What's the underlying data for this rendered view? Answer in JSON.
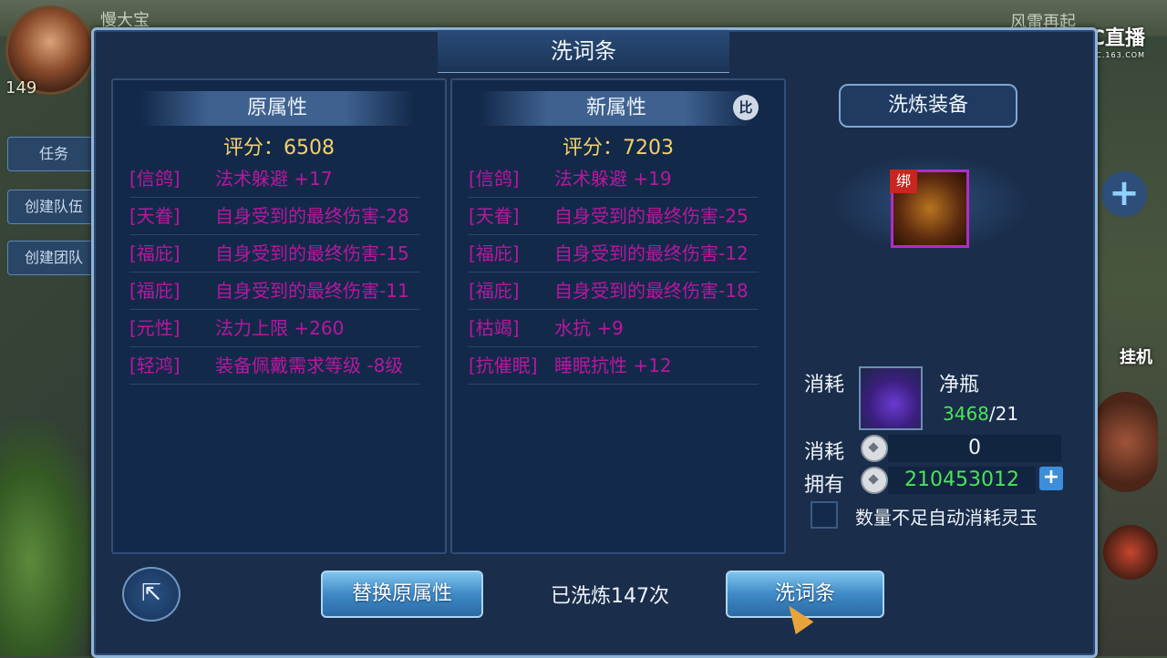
{
  "background": {
    "player_name": "慢大宝",
    "level": "149",
    "side_buttons": [
      "任务",
      "创建队伍",
      "创建团队"
    ],
    "top_right_text": "风雷再起",
    "right_hang": "挂机",
    "stream_logo": "CC直播",
    "stream_logo_sub": "CC.163.COM"
  },
  "dialog": {
    "title": "洗词条"
  },
  "original": {
    "header": "原属性",
    "score": "评分：6508",
    "attributes": [
      {
        "tag": "[信鸽]",
        "text": "法术躲避 +17"
      },
      {
        "tag": "[天眷]",
        "text": "自身受到的最终伤害-28"
      },
      {
        "tag": "[福庇]",
        "text": "自身受到的最终伤害-15"
      },
      {
        "tag": "[福庇]",
        "text": "自身受到的最终伤害-11"
      },
      {
        "tag": "[元性]",
        "text": "法力上限 +260"
      },
      {
        "tag": "[轻鸿]",
        "text": "装备佩戴需求等级 -8级"
      }
    ]
  },
  "new": {
    "header": "新属性",
    "compare_badge": "比",
    "score": "评分：7203",
    "attributes": [
      {
        "tag": "[信鸽]",
        "text": "法术躲避 +19"
      },
      {
        "tag": "[天眷]",
        "text": "自身受到的最终伤害-25"
      },
      {
        "tag": "[福庇]",
        "text": "自身受到的最终伤害-12"
      },
      {
        "tag": "[福庇]",
        "text": "自身受到的最终伤害-18"
      },
      {
        "tag": "[枯竭]",
        "text": "水抗 +9"
      },
      {
        "tag": "[抗催眠]",
        "text": "睡眠抗性 +12"
      }
    ]
  },
  "equip": {
    "header": "洗炼装备",
    "bind_tag": "绑"
  },
  "cost": {
    "consume_label": "消耗",
    "item_name": "净瓶",
    "item_have": "3468",
    "item_need": "/21",
    "coin_consume_label": "消耗",
    "coin_consume_value": "0",
    "own_label": "拥有",
    "own_value": "210453012",
    "plus": "+",
    "auto_text": "数量不足自动消耗灵玉"
  },
  "footer": {
    "replace_button": "替换原属性",
    "wash_count": "已洗炼147次",
    "wash_button": "洗词条"
  },
  "colors": {
    "attribute": "#b8179f",
    "score": "#f2d26a",
    "owned": "#49e45a"
  }
}
